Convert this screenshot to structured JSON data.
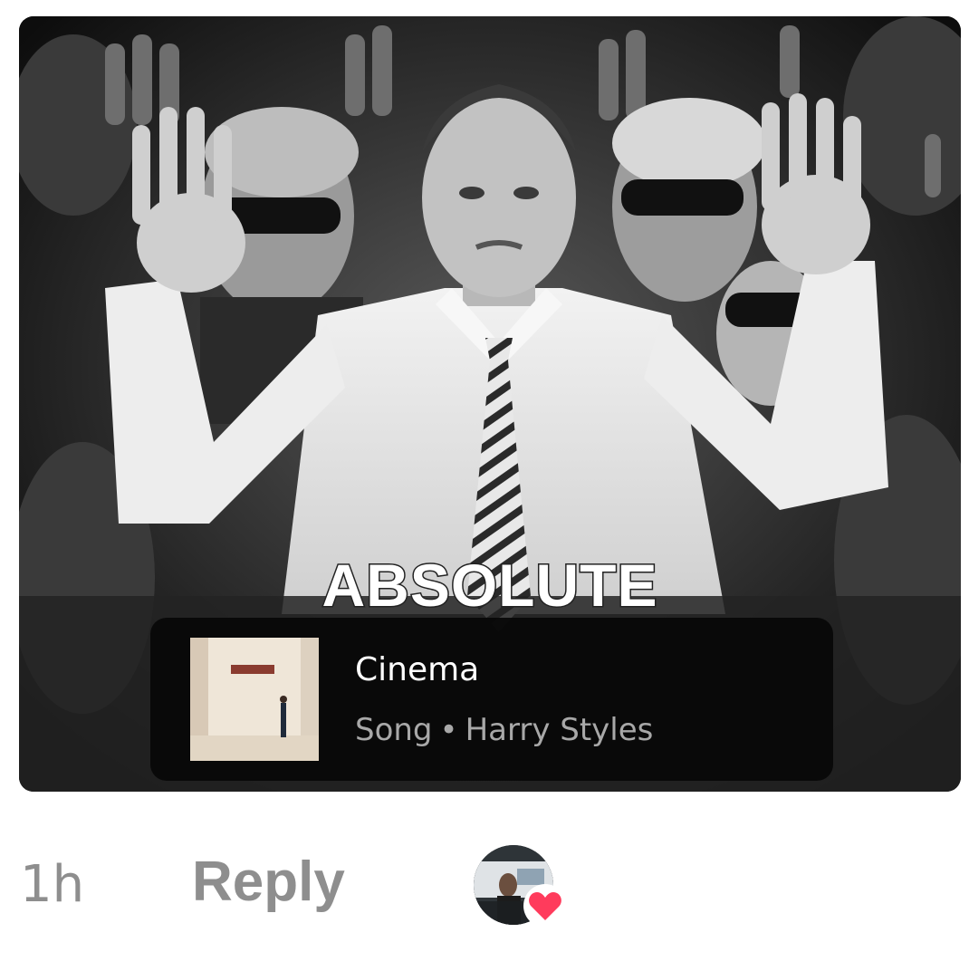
{
  "media": {
    "caption": "ABSOLUTE",
    "song": {
      "title": "Cinema",
      "type": "Song",
      "separator": "•",
      "artist": "Harry Styles",
      "artwork_icon": "album-art-image"
    }
  },
  "comment_footer": {
    "time": "1h",
    "reply_label": "Reply",
    "liked_by_icon": "avatar-with-heart-icon"
  },
  "colors": {
    "heart": "#ff3b5c",
    "muted_text": "#8e8e8e",
    "song_card_bg": "#080808"
  }
}
